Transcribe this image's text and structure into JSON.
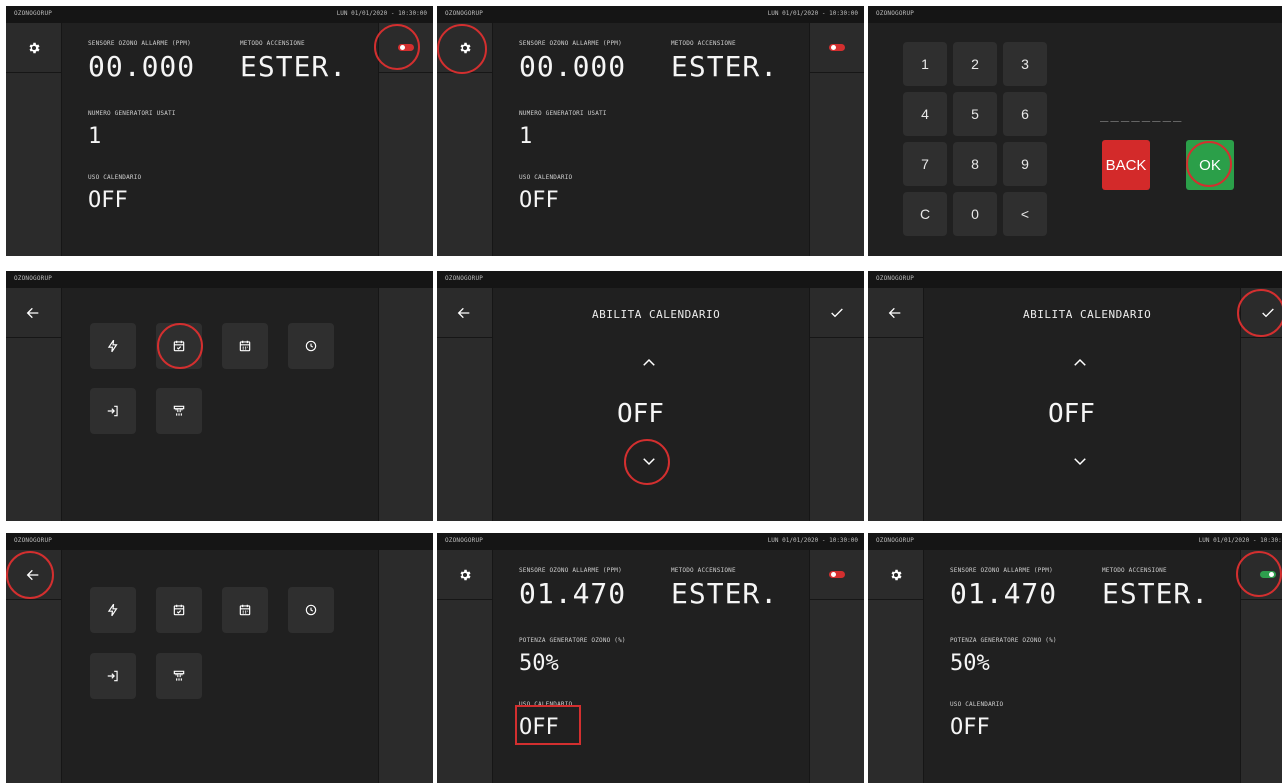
{
  "app": {
    "brand": "OZONOGORUP",
    "datetime": "LUN 01/01/2020 - 10:30:00"
  },
  "colors": {
    "panel_bg": "#202020",
    "side_bg": "#2b2b2b",
    "toggle_off": "#d32f2f",
    "toggle_on": "#2e9e4d",
    "highlight": "#d32f2f",
    "back_btn": "#d32a2a",
    "ok_btn": "#2b9f49"
  },
  "icons": {
    "settings": "gear-icon",
    "back": "arrow-left-icon",
    "confirm": "check-icon",
    "up": "chevron-up-icon",
    "down": "chevron-down-icon"
  },
  "status1": {
    "sensor_label": "SENSORE OZONO ALLARME (PPM)",
    "sensor_value": "00.000",
    "method_label": "METODO ACCENSIONE",
    "method_value": "ESTER.",
    "generators_label": "NUMERO GENERATORI USATI",
    "generators_value": "1",
    "calendar_label": "USO CALENDARIO",
    "calendar_value": "OFF",
    "toggle": "off"
  },
  "keypad": {
    "keys": [
      "1",
      "2",
      "3",
      "4",
      "5",
      "6",
      "7",
      "8",
      "9",
      "C",
      "0",
      "<"
    ],
    "back_label": "BACK",
    "ok_label": "OK",
    "input_placeholder": "________"
  },
  "menu": {
    "icons": [
      "bolt-icon",
      "calendar-check-icon",
      "calendar-grid-icon",
      "clock-icon",
      "login-icon",
      "ozone-generator-icon"
    ]
  },
  "enable_calendar": {
    "title": "ABILITA CALENDARIO",
    "value": "OFF"
  },
  "status2": {
    "sensor_label": "SENSORE OZONO ALLARME (PPM)",
    "sensor_value": "01.470",
    "method_label": "METODO ACCENSIONE",
    "method_value": "ESTER.",
    "power_label": "POTENZA GENERATORE OZONO (%)",
    "power_value": "50%",
    "calendar_label": "USO CALENDARIO",
    "calendar_value": "OFF"
  }
}
